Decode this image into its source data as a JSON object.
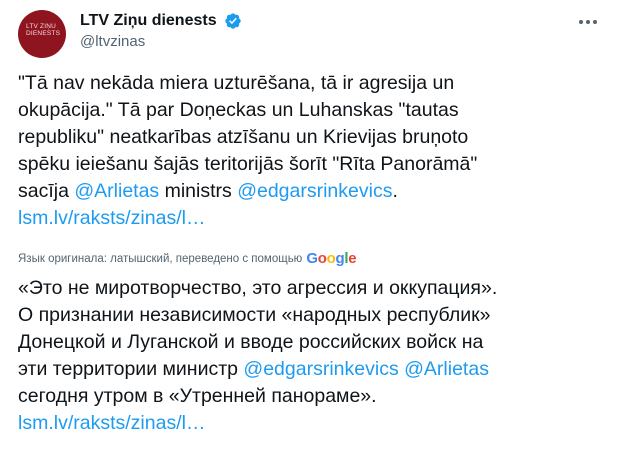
{
  "author": {
    "display_name": "LTV Ziņu dienests",
    "handle": "@ltvzinas",
    "avatar_text": "LTV ZIŅU DIENESTS"
  },
  "original": {
    "line1": "\"Tā nav nekāda miera uzturēšana, tā ir agresija un",
    "line2": "okupācija.\" Tā par Doņeckas un Luhanskas \"tautas",
    "line3": "republiku\" neatkarības atzīšanu un Krievijas bruņoto",
    "line4": "spēku ieiešanu šajās teritorijās šorīt \"Rīta Panorāmā\"",
    "line5_pre": "sacīja ",
    "mention1": "@Arlietas",
    "line5_mid": " ministrs ",
    "mention2": "@edgarsrinkevics",
    "line5_post": ".",
    "link": "lsm.lv/raksts/zinas/l…"
  },
  "translation": {
    "label": "Язык оригинала: латышский, переведено с помощью",
    "line1": "«Это не миротворчество, это агрессия и оккупация».",
    "line2": "О признании независимости «народных республик»",
    "line3": "Донецкой и Луганской и вводе российских войск на",
    "line4_pre": "эти территории министр ",
    "mention1": "@edgarsrinkevics",
    "line4_mid": " ",
    "mention2": "@Arlietas",
    "line5": "сегодня утром в «Утренней панораме».",
    "link": "lsm.lv/raksts/zinas/l…"
  },
  "google_logo": {
    "letters": [
      "G",
      "o",
      "o",
      "g",
      "l",
      "e"
    ],
    "colors": [
      "#4285F4",
      "#EA4335",
      "#FBBC05",
      "#4285F4",
      "#34A853",
      "#EA4335"
    ]
  },
  "icons": {
    "verified": "verified-badge-icon",
    "more": "more-options-icon"
  },
  "colors": {
    "link": "#1d9bf0",
    "text": "#0f1419",
    "secondary": "#536471",
    "avatar_bg": "#8e1520"
  }
}
